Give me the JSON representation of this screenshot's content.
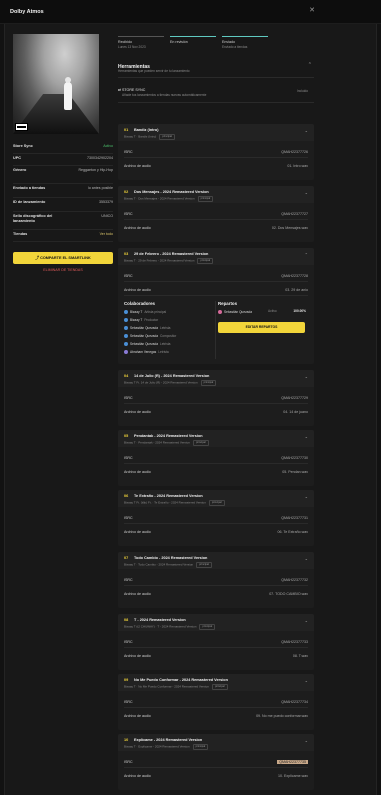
{
  "window": {
    "title": "Dolby Atmos"
  },
  "album": {
    "meta": [
      {
        "k": "Store Sync",
        "v": "Activo",
        "cls": "green"
      },
      {
        "k": "UPC",
        "v": "7300342902204",
        "cls": ""
      },
      {
        "k": "Género",
        "v": "Reggaeton y Hip-Hop",
        "cls": ""
      },
      {
        "k": "Enviado a tiendas",
        "v": "lo antes posible",
        "cls": ""
      },
      {
        "k": "ID de lanzamiento",
        "v": "3553379",
        "cls": ""
      },
      {
        "k": "Sello discográfico del lanzamiento",
        "v": "UNICO",
        "cls": ""
      },
      {
        "k": "Tiendas",
        "v": "Ver todo",
        "cls": "lnk"
      }
    ],
    "share_label": "COMPARTE EL SMARTLINK",
    "delete_label": "ELIMINAR DE TIENDAS"
  },
  "status_tabs": [
    {
      "a": "Recibido",
      "b": "Lunes 13 Nov 2023"
    },
    {
      "a": "En revisión",
      "b": ""
    },
    {
      "a": "Enviado",
      "b": "Enviado a tiendas"
    }
  ],
  "tools": {
    "title": "Herramientas",
    "subtitle": "Herramientas que pueden servir de tu lanzamiento",
    "store_sync": "STORE SYNC",
    "store_sync_desc": "Añade tus lanzamientos a tiendas nuevas automáticamente",
    "store_sync_status": "Incluido",
    "collapse_icon": "chevron-up-icon"
  },
  "labels": {
    "isrc": "ISRC",
    "audio": "Archivo de audio"
  },
  "tracks": [
    {
      "num": "01",
      "name": "Bandiz (Intro)",
      "sub": "Bizaay T · Bandiz (Intro)",
      "pill": "principal",
      "isrc": "QMAH22377726",
      "file": "01. Intro.wav"
    },
    {
      "num": "02",
      "name": "Dos Mensajes - 2024 Remastered Version",
      "sub": "Bizaay T · Dos Mensajes - 2024 Remastered Version",
      "pill": "principal",
      "isrc": "QMAH22377727",
      "file": "02. Dos Mensajes.wav"
    },
    {
      "num": "03",
      "name": "29 de Febrero - 2024 Remastered Version",
      "sub": "Bizaay T · 29 de Febrero - 2024 Remastered Version",
      "pill": "principal",
      "isrc": "QMAH22377728",
      "file": "03. 29 de anio",
      "expanded": true
    },
    {
      "num": "04",
      "name": "14 de Julio (R) - 2024 Remastered Version",
      "sub": "Bizaay T Ft. 14 de Julio (R) - 2024 Remastered Version",
      "pill": "principal",
      "isrc": "QMAH22377729",
      "file": "04. 14 de juano"
    },
    {
      "num": "05",
      "name": "Pendantak - 2024 Remastered Version",
      "sub": "Bizaay T · Pendantak - 2024 Remastered Version",
      "pill": "principal",
      "isrc": "QMAH22377730",
      "file": "05. Pendan.wav"
    },
    {
      "num": "06",
      "name": "Te Extraño - 2024 Remastered Version",
      "sub": "Bizaay T Ft. (Wp) Ft. · Te Extraño - 2024 Remastered Version",
      "pill": "principal",
      "isrc": "QMAH22377731",
      "file": "06. Te Extraño.wav"
    },
    {
      "num": "07",
      "name": "Todo Cambio - 2024 Remastered Version",
      "sub": "Bizaay T · Todo Cambio - 2024 Remastered Version",
      "pill": "principal",
      "isrc": "QMAH22377732",
      "file": "07. TODO CAMBIO.wav"
    },
    {
      "num": "08",
      "name": "T - 2024 Remastered Version",
      "sub": "Bizaay T (t2 CHUWAY) · T - 2024 Remastered Version",
      "pill": "principal",
      "isrc": "QMAH22377733",
      "file": "08. T.wav"
    },
    {
      "num": "09",
      "name": "No Me Puedo Conformar - 2024 Remastered Version",
      "sub": "Bizaay T · No Me Puedo Conformar - 2024 Remastered Version",
      "pill": "principal",
      "isrc": "QMAH22377734",
      "file": "09. No me puedo conformar.wav"
    },
    {
      "num": "10",
      "name": "Explícame - 2024 Remastered Version",
      "sub": "Bizaay T · Explícame - 2024 Remastered Version",
      "pill": "principal",
      "isrc": "QMAH22377735",
      "file": "10. Explicame.wav"
    }
  ],
  "collaborators": {
    "title": "Colaboradores",
    "rows": [
      {
        "name": "Bizaay T",
        "role": "Artista principal"
      },
      {
        "name": "Bizaay T",
        "role": "Productor"
      },
      {
        "name": "Sebastián Quezada",
        "role": "Letrista"
      },
      {
        "name": "Sebastián Quezada",
        "role": "Compositor"
      },
      {
        "name": "Sebastián Quezada",
        "role": "Letrista"
      },
      {
        "name": "Abraham Venegas",
        "role": "Letrista"
      }
    ]
  },
  "splits": {
    "title": "Repartos",
    "name": "Sebastián Quezada",
    "status": "Activo",
    "pct": "100.00%",
    "button": "EDITAR REPARTOS"
  }
}
